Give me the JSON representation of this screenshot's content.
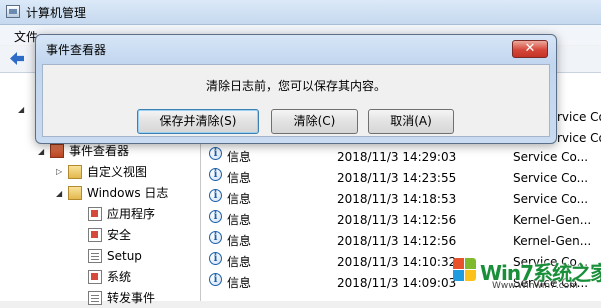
{
  "window": {
    "title": "计算机管理"
  },
  "menubar": {
    "file": "文件"
  },
  "tree": {
    "event_viewer": "事件查看器",
    "custom_views": "自定义视图",
    "windows_logs": "Windows 日志",
    "application": "应用程序",
    "security": "安全",
    "setup": "Setup",
    "system": "系统",
    "forwarded": "转发事件"
  },
  "events": [
    {
      "level": "信息",
      "datetime": "2018/11/3 14:29:03",
      "source": "Service Co..."
    },
    {
      "level": "信息",
      "datetime": "2018/11/3 14:23:55",
      "source": "Service Co..."
    },
    {
      "level": "信息",
      "datetime": "2018/11/3 14:18:53",
      "source": "Service Co..."
    },
    {
      "level": "信息",
      "datetime": "2018/11/3 14:12:56",
      "source": "Kernel-Gen..."
    },
    {
      "level": "信息",
      "datetime": "2018/11/3 14:12:56",
      "source": "Kernel-Gen..."
    },
    {
      "level": "信息",
      "datetime": "2018/11/3 14:10:32",
      "source": "Service Co..."
    },
    {
      "level": "信息",
      "datetime": "2018/11/3 14:09:03",
      "source": "Service Co..."
    }
  ],
  "partial_sources": [
    "rvice Co",
    "rvice Co"
  ],
  "dialog": {
    "title": "事件查看器",
    "close": "✕",
    "message": "清除日志前，您可以保存其内容。",
    "save_clear": "保存并清除(S)",
    "clear": "清除(C)",
    "cancel": "取消(A)"
  },
  "watermark": {
    "text": "Win7系统之家",
    "url": "Www.Winwin7.com"
  },
  "colors": {
    "accent": "#3c7fb1",
    "close_button": "#d5473a",
    "info_icon": "#1d5fa8"
  }
}
